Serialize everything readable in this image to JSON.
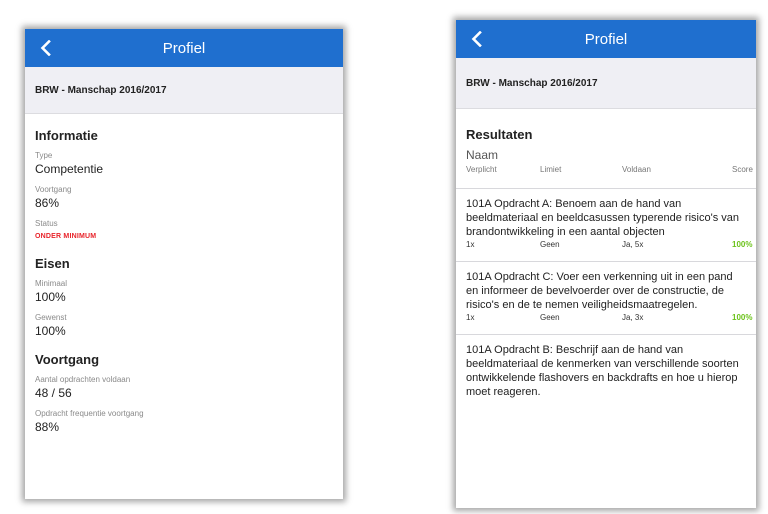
{
  "left": {
    "nav_title": "Profiel",
    "group": "BRW - Manschap 2016/2017",
    "informatie": {
      "heading": "Informatie",
      "type_label": "Type",
      "type_value": "Competentie",
      "voortgang_label": "Voortgang",
      "voortgang_value": "86%",
      "status_label": "Status",
      "status_value": "ONDER MINIMUM"
    },
    "eisen": {
      "heading": "Eisen",
      "minimaal_label": "Minimaal",
      "minimaal_value": "100%",
      "gewenst_label": "Gewenst",
      "gewenst_value": "100%"
    },
    "voortgang": {
      "heading": "Voortgang",
      "aantal_label": "Aantal opdrachten voldaan",
      "aantal_value": "48 / 56",
      "freq_label": "Opdracht frequentie voortgang",
      "freq_value": "88%"
    }
  },
  "right": {
    "nav_title": "Profiel",
    "group": "BRW - Manschap 2016/2017",
    "heading": "Resultaten",
    "columns": {
      "naam": "Naam",
      "verplicht": "Verplicht",
      "limiet": "Limiet",
      "voldaan": "Voldaan",
      "score": "Score"
    },
    "items": [
      {
        "desc": "101A Opdracht A: Benoem aan de hand van beeldmateriaal en beeldcasussen typerende risico's van brandontwikkeling in een aantal objecten",
        "verplicht": "1x",
        "limiet": "Geen",
        "voldaan": "Ja, 5x",
        "score": "100%"
      },
      {
        "desc": "101A Opdracht C: Voer een verkenning uit in een pand en informeer de bevelvoerder over de constructie, de risico's en de te nemen veiligheidsmaatregelen.",
        "verplicht": "1x",
        "limiet": "Geen",
        "voldaan": "Ja, 3x",
        "score": "100%"
      },
      {
        "desc": "101A Opdracht B: Beschrijf aan de hand van beeldmateriaal de kenmerken van verschillende soorten ontwikkelende flashovers en backdrafts en hoe u hierop moet reageren."
      }
    ]
  },
  "colors": {
    "navbar": "#1f6fcf",
    "status_red": "#e8232a",
    "score_green": "#6cc31b",
    "group_bg": "#efeff4"
  },
  "icons": {
    "back": "chevron-left-icon"
  }
}
